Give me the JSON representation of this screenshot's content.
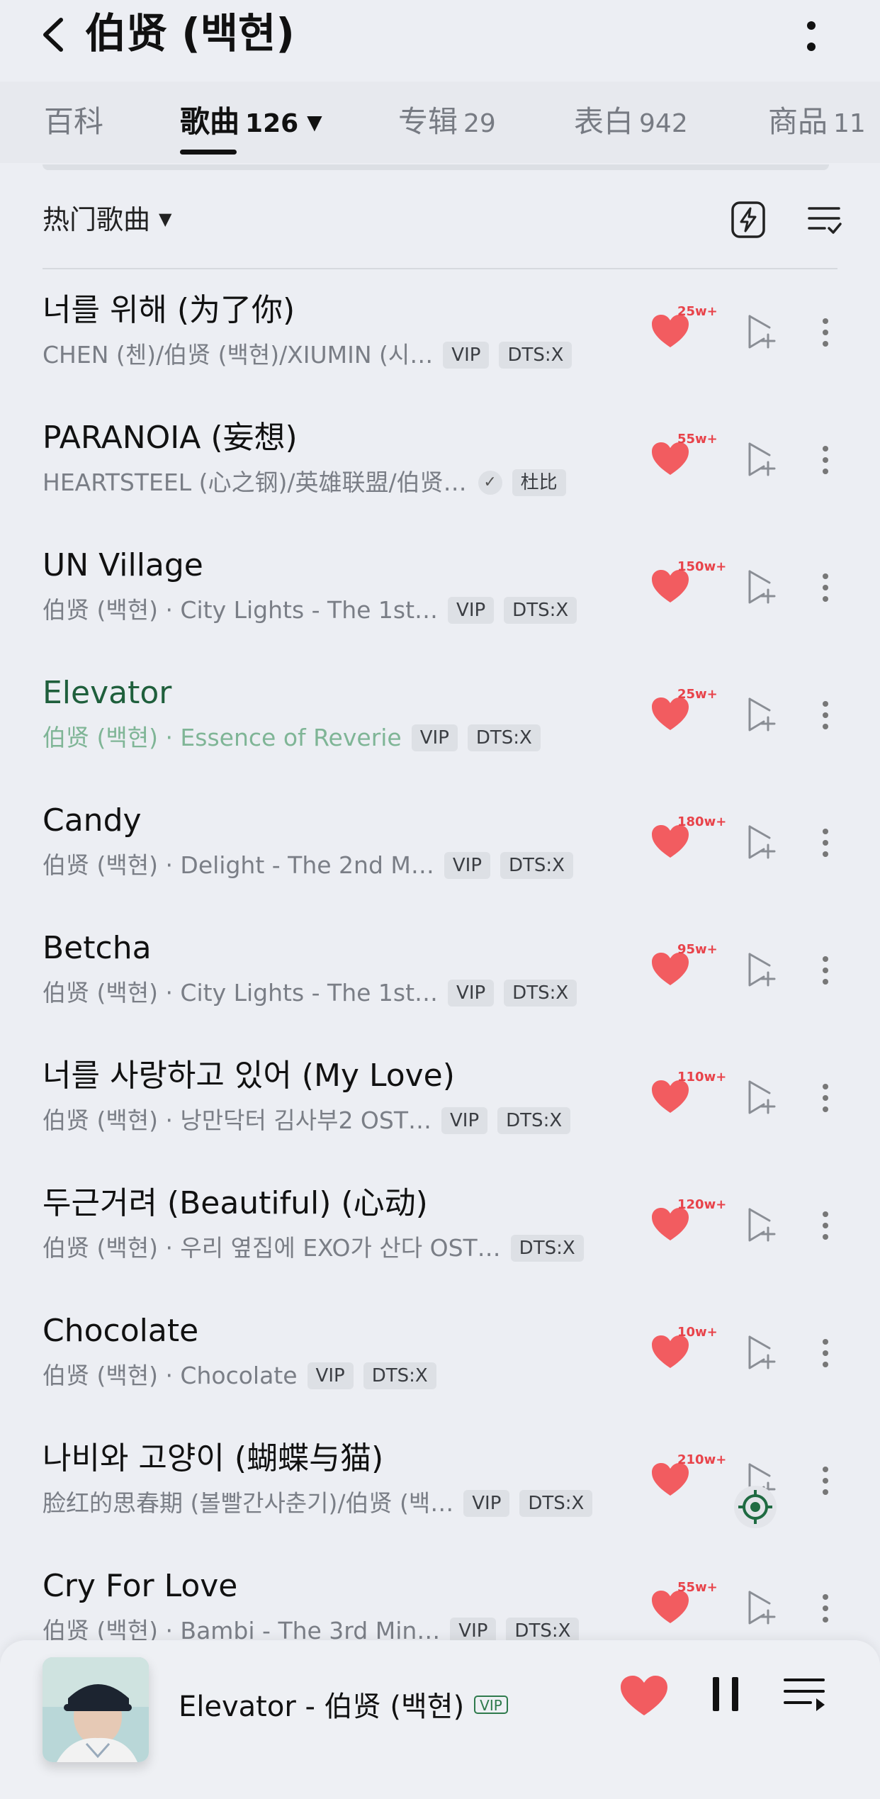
{
  "header": {
    "title": "伯贤 (백현)"
  },
  "tabs": [
    {
      "label": "百科",
      "count": ""
    },
    {
      "label": "歌曲",
      "count": "126"
    },
    {
      "label": "专辑",
      "count": "29"
    },
    {
      "label": "表白",
      "count": "942"
    },
    {
      "label": "商品",
      "count": "11"
    }
  ],
  "section": {
    "title": "热门歌曲"
  },
  "songs": [
    {
      "title": "너를 위해 (为了你)",
      "subtitle": "CHEN (첸)/伯贤 (백현)/XIUMIN (시…",
      "badges": [
        "VIP",
        "DTS:X"
      ],
      "likes": "25w+"
    },
    {
      "title": "PARANOIA (妄想)",
      "subtitle": "HEARTSTEEL (心之钢)/英雄联盟/伯贤…",
      "badges": [
        "杜比"
      ],
      "likes": "55w+"
    },
    {
      "title": "UN Village",
      "subtitle": "伯贤 (백현) · City Lights - The 1st…",
      "badges": [
        "VIP",
        "DTS:X"
      ],
      "likes": "150w+"
    },
    {
      "title": "Elevator",
      "subtitle": "伯贤 (백현) · Essence of Reverie",
      "badges": [
        "VIP",
        "DTS:X"
      ],
      "likes": "25w+"
    },
    {
      "title": "Candy",
      "subtitle": "伯贤 (백현) · Delight - The 2nd M…",
      "badges": [
        "VIP",
        "DTS:X"
      ],
      "likes": "180w+"
    },
    {
      "title": "Betcha",
      "subtitle": "伯贤 (백현) · City Lights - The 1st…",
      "badges": [
        "VIP",
        "DTS:X"
      ],
      "likes": "95w+"
    },
    {
      "title": "너를 사랑하고 있어 (My Love)",
      "subtitle": "伯贤 (백현) · 낭만닥터 김사부2 OST…",
      "badges": [
        "VIP",
        "DTS:X"
      ],
      "likes": "110w+"
    },
    {
      "title": "두근거려 (Beautiful) (心动)",
      "subtitle": "伯贤 (백현) · 우리 옆집에 EXO가 산다 OST…",
      "badges": [
        "DTS:X"
      ],
      "likes": "120w+"
    },
    {
      "title": "Chocolate",
      "subtitle": "伯贤 (백현) · Chocolate",
      "badges": [
        "VIP",
        "DTS:X"
      ],
      "likes": "10w+"
    },
    {
      "title": "나비와 고양이 (蝴蝶与猫)",
      "subtitle": "脸红的思春期 (볼빨간사춘기)/伯贤 (백…",
      "badges": [
        "VIP",
        "DTS:X"
      ],
      "likes": "210w+"
    },
    {
      "title": "Cry For Love",
      "subtitle": "伯贤 (백현) · Bambi - The 3rd Min…",
      "badges": [
        "VIP",
        "DTS:X"
      ],
      "likes": "55w+"
    }
  ],
  "player": {
    "song": "Elevator - 伯贤 (백현)",
    "vip": "VIP"
  },
  "colors": {
    "background": "#eceef3",
    "playing_green": "#1f5f3c",
    "heart_red": "#f25c60"
  }
}
